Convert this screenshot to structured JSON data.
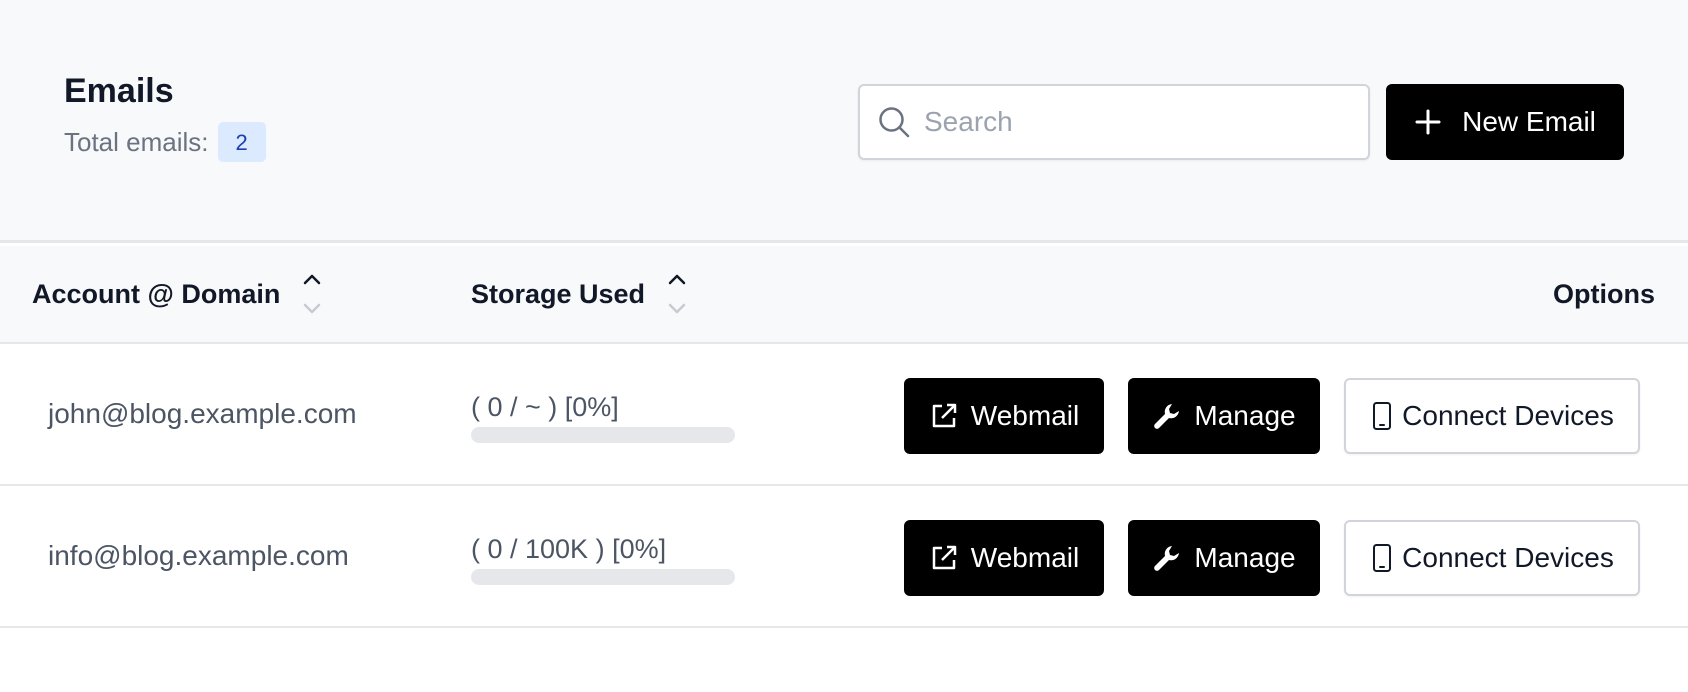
{
  "header": {
    "title": "Emails",
    "total_label": "Total emails:",
    "total_count": "2",
    "search_placeholder": "Search",
    "new_button_label": "New Email"
  },
  "table": {
    "columns": {
      "account": "Account @ Domain",
      "storage": "Storage Used",
      "options": "Options"
    },
    "rows": [
      {
        "email": "john@blog.example.com",
        "storage": "( 0 / ~ ) [0%]",
        "storage_percent": 0,
        "webmail_label": "Webmail",
        "manage_label": "Manage",
        "connect_label": "Connect Devices"
      },
      {
        "email": "info@blog.example.com",
        "storage": "( 0 / 100K ) [0%]",
        "storage_percent": 0,
        "webmail_label": "Webmail",
        "manage_label": "Manage",
        "connect_label": "Connect Devices"
      }
    ]
  },
  "icons": {
    "search": "search-icon",
    "new": "plus-icon",
    "sort": "sort-icon",
    "webmail": "external-link-icon",
    "manage": "wrench-icon",
    "connect": "mobile-phone-icon"
  },
  "colors": {
    "header_bg": "#f8f9fb",
    "primary_button": "#000000",
    "badge_bg": "#dbeafe",
    "badge_text": "#1e40af",
    "progress_track": "#e5e7eb"
  }
}
